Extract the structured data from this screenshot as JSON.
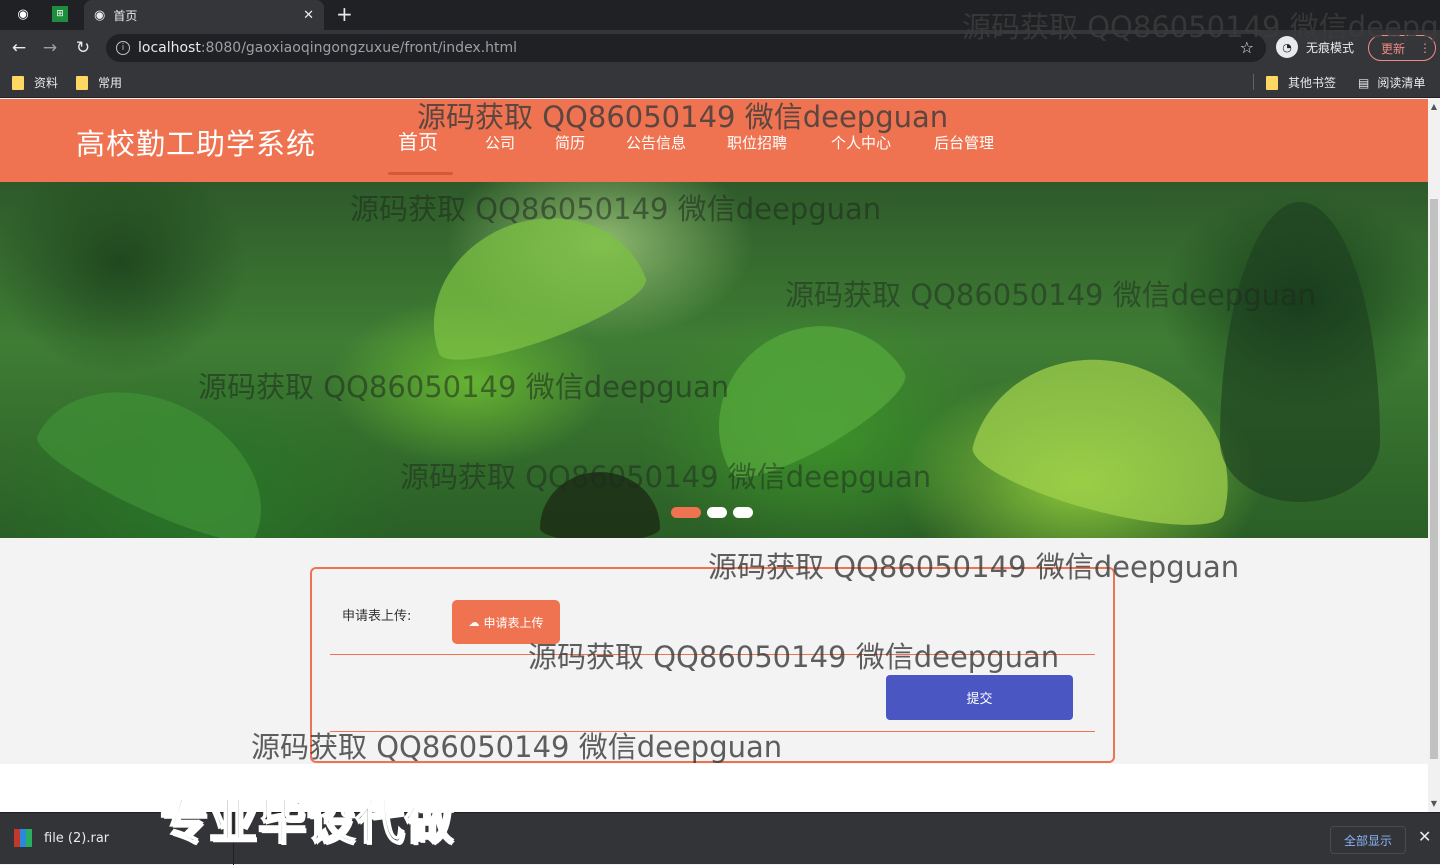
{
  "browser": {
    "tab_title": "首页",
    "url_host": "localhost",
    "url_path": ":8080/gaoxiaoqingongzuxue/front/index.html",
    "incognito_label": "无痕模式",
    "update_label": "更新",
    "bookmarks": [
      "资料",
      "常用"
    ],
    "other_bookmarks": "其他书签",
    "reading_list": "阅读清单"
  },
  "site": {
    "title": "高校勤工助学系统",
    "nav": [
      "首页",
      "公司",
      "简历",
      "公告信息",
      "职位招聘",
      "个人中心",
      "后台管理"
    ]
  },
  "carousel": {
    "slide_count": 3,
    "active_index": 0
  },
  "form": {
    "upload_label": "申请表上传:",
    "upload_button": "申请表上传",
    "submit_button": "提交"
  },
  "download_bar": {
    "file_name": "file (2).rar",
    "show_all": "全部显示"
  },
  "overlays": {
    "watermark": "源码获取 QQ86050149 微信deepguan",
    "watermark_cut": "源码获取 QQ86050149 微信deepg",
    "promo": "专业毕设代做"
  },
  "colors": {
    "header": "#ef7350",
    "submit": "#4a56c2",
    "chrome_dark": "#202124",
    "chrome": "#35363a"
  }
}
